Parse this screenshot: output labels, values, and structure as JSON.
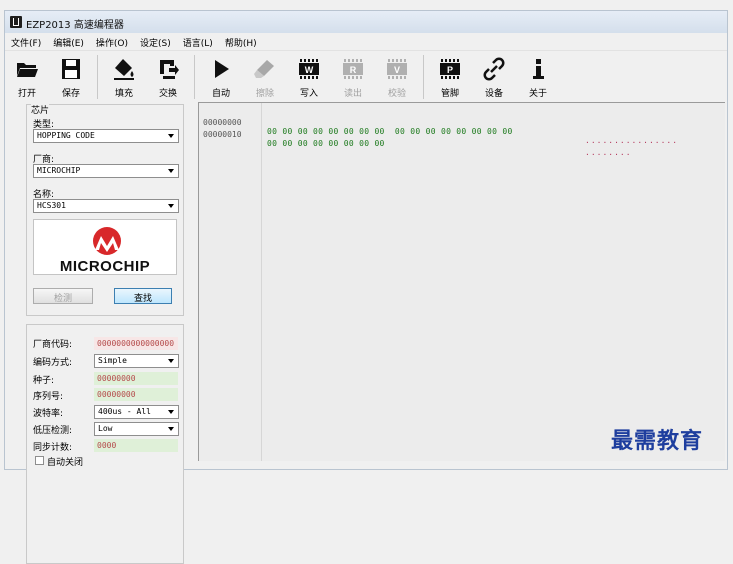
{
  "window": {
    "title": "EZP2013 高速编程器"
  },
  "menu": [
    "文件(F)",
    "编辑(E)",
    "操作(O)",
    "设定(S)",
    "语言(L)",
    "帮助(H)"
  ],
  "toolbar": [
    {
      "label": "打开",
      "icon": "folder-icon",
      "disabled": false
    },
    {
      "label": "保存",
      "icon": "save-icon",
      "disabled": false
    },
    {
      "label": "填充",
      "icon": "fill-icon",
      "disabled": false
    },
    {
      "label": "交换",
      "icon": "swap-icon",
      "disabled": false
    },
    {
      "label": "自动",
      "icon": "play-icon",
      "disabled": false
    },
    {
      "label": "擦除",
      "icon": "erase-icon",
      "disabled": true
    },
    {
      "label": "写入",
      "icon": "chip-write-icon",
      "disabled": false,
      "chip_letter": "W"
    },
    {
      "label": "读出",
      "icon": "chip-read-icon",
      "disabled": true,
      "chip_letter": "R"
    },
    {
      "label": "校验",
      "icon": "chip-verify-icon",
      "disabled": true,
      "chip_letter": "V"
    },
    {
      "label": "管脚",
      "icon": "chip-pin-icon",
      "disabled": false,
      "chip_letter": "P"
    },
    {
      "label": "设备",
      "icon": "link-icon",
      "disabled": false
    },
    {
      "label": "关于",
      "icon": "info-icon",
      "disabled": false
    }
  ],
  "chip_panel": {
    "group_label": "芯片",
    "type_label": "类型:",
    "type_value": "HOPPING CODE",
    "vendor_label": "厂商:",
    "vendor_value": "MICROCHIP",
    "name_label": "名称:",
    "name_value": "HCS301",
    "logo_text": "MICROCHIP",
    "detect_button": "检测",
    "search_button": "查找"
  },
  "code_panel": {
    "vendor_code_label": "厂商代码:",
    "vendor_code_value": "0000000000000000",
    "encoding_label": "编码方式:",
    "encoding_value": "Simple",
    "seed_label": "种子:",
    "seed_value": "00000000",
    "serial_label": "序列号:",
    "serial_value": "00000000",
    "baud_label": "波特率:",
    "baud_value": "400us - All",
    "lowv_label": "低压检测:",
    "lowv_value": "Low",
    "sync_label": "同步计数:",
    "sync_value": "0000",
    "autoclose_label": "自动关闭"
  },
  "hex_view": {
    "rows": [
      {
        "addr": "00000000",
        "hex": "00 00 00 00 00 00 00 00  00 00 00 00 00 00 00 00",
        "ascii": "................"
      },
      {
        "addr": "00000010",
        "hex": "00 00 00 00 00 00 00 00",
        "ascii": "........"
      }
    ]
  },
  "watermark": "最需教育",
  "colors": {
    "hex": "#1d7a1d",
    "ascii": "#b4355a",
    "field_text": "#b44a4a",
    "watermark": "#1e3e9e"
  }
}
